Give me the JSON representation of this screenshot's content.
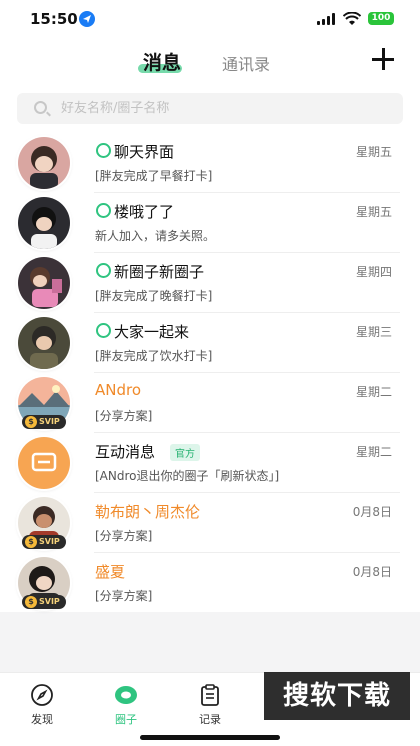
{
  "status_bar": {
    "time": "15:50",
    "battery": "100"
  },
  "header": {
    "tab_messages": "消息",
    "tab_contacts": "通讯录"
  },
  "search": {
    "placeholder": "好友名称/圈子名称"
  },
  "conversations": [
    {
      "title": "聊天界面",
      "subtitle": "[胖友完成了早餐打卡]",
      "time": "星期五",
      "online": true
    },
    {
      "title": "楼哦了了",
      "subtitle": "新人加入，请多关照。",
      "time": "星期五",
      "online": true
    },
    {
      "title": "新圈子新圈子",
      "subtitle": "[胖友完成了晚餐打卡]",
      "time": "星期四",
      "online": true
    },
    {
      "title": "大家一起来",
      "subtitle": "[胖友完成了饮水打卡]",
      "time": "星期三",
      "online": true
    },
    {
      "title": "ANdro",
      "subtitle": "[分享方案]",
      "time": "星期二",
      "svip": "SVIP"
    },
    {
      "title": "互动消息",
      "badge": "官方",
      "subtitle": "[ANdro退出你的圈子「刷新状态」]",
      "time": "星期二"
    },
    {
      "title": "勒布朗丶周杰伦",
      "subtitle": "[分享方案]",
      "time": "0月8日",
      "svip": "SVIP"
    },
    {
      "title": "盛夏",
      "subtitle": "[分享方案]",
      "time": "0月8日",
      "svip": "SVIP"
    }
  ],
  "tabbar": {
    "discover": "发现",
    "circle": "圈子",
    "records": "记录"
  },
  "watermark": "搜软下载",
  "colors": {
    "accent": "#2fc480",
    "vip_name": "#f08a2a"
  }
}
